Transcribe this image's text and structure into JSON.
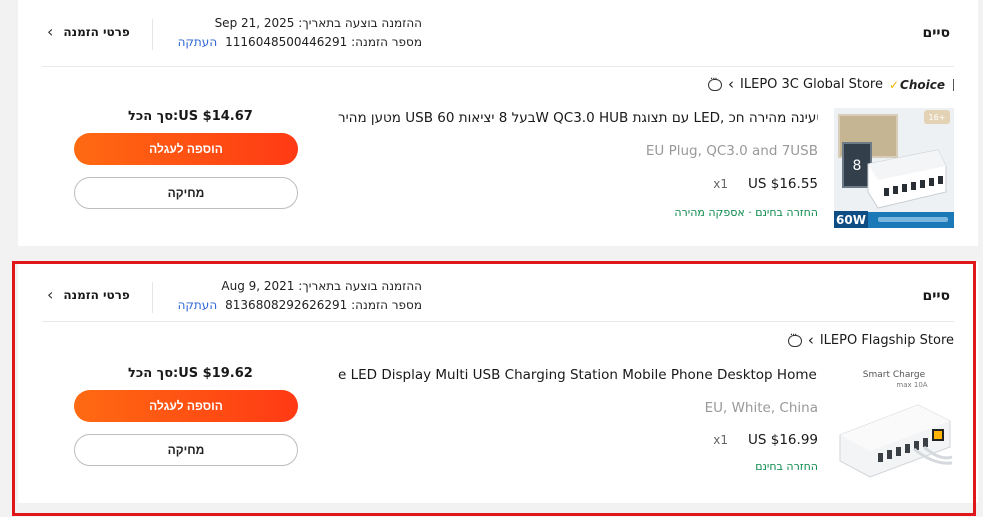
{
  "orders": [
    {
      "status": "סיים",
      "placed_label": "ההזמנה בוצעה בתאריך:",
      "placed_date": "Sep 21, 2025",
      "number_label": "מספר הזמנה:",
      "number": "1116048500446291",
      "copy_label": "העתקה",
      "details_label": "פרטי הזמנה",
      "choice_label": "Choice",
      "store_name": "ILEPO 3C Global Store",
      "item": {
        "title": "מטען מהיר USB בעל 8 יציאות 60W QC3.0 HUB עם תצוגת LED, טעינה מהירה חכ...",
        "variant": "EU Plug, QC3.0 and 7USB",
        "price": "US $16.55",
        "qty": "x1",
        "perks": "החזרה בחינם · אספקה מהירה",
        "image_icon": "usb-charger-60w-image"
      },
      "total": "סך הכל:US $14.67",
      "add_to_cart_label": "הוספה לעגלה",
      "delete_label": "מחיקה"
    },
    {
      "status": "סיים",
      "placed_label": "ההזמנה בוצעה בתאריך:",
      "placed_date": "Aug 9, 2021",
      "number_label": "מספר הזמנה:",
      "number": "8136808292626291",
      "copy_label": "העתקה",
      "details_label": "פרטי הזמנה",
      "store_name": "ILEPO Flagship Store",
      "item": {
        "title": "e LED Display Multi USB Charging Station Mobile Phone Desktop Home...",
        "variant": "EU, White, China",
        "price": "US $16.99",
        "qty": "x1",
        "perks": "החזרה בחינם",
        "image_icon": "smart-charge-station-image",
        "image_caption": "Smart Charge",
        "image_subcaption": "max 10A"
      },
      "total": "סך הכל:US $19.62",
      "add_to_cart_label": "הוספה לעגלה",
      "delete_label": "מחיקה"
    }
  ],
  "colors": {
    "accent_start": "#ff6a12",
    "accent_end": "#ff3a14",
    "highlight_border": "#e0161b",
    "link": "#2f66d6",
    "perks": "#0a8a4a"
  }
}
